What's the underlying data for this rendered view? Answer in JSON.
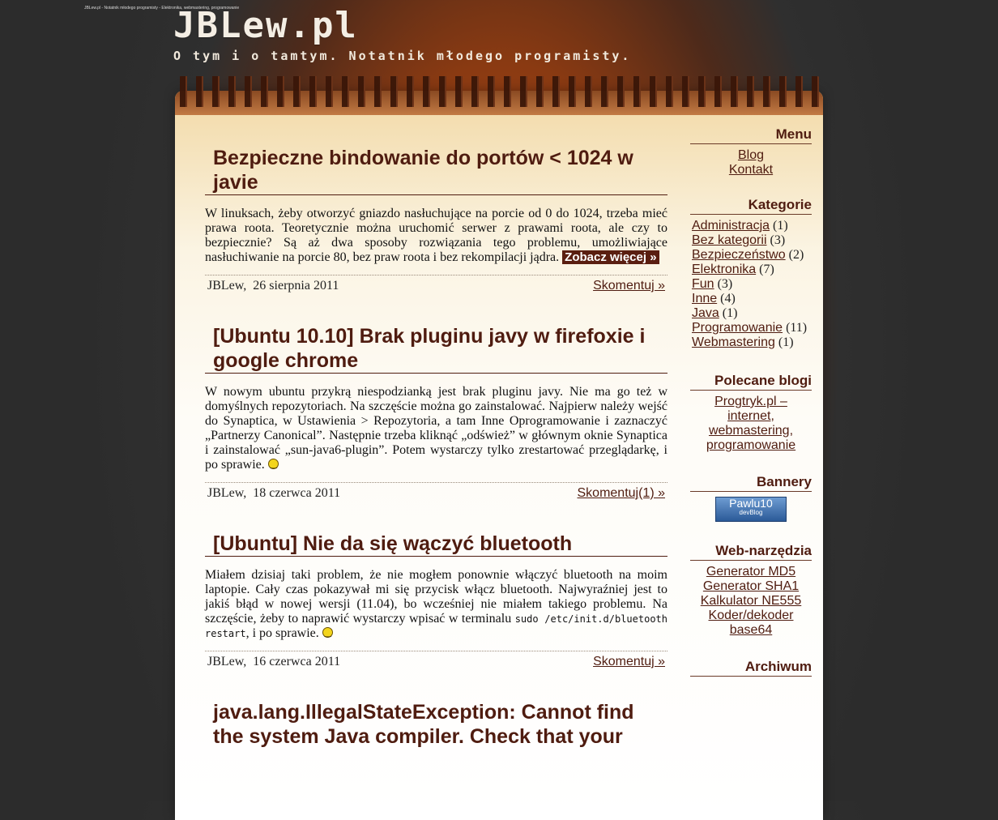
{
  "window": {
    "title": "JBLew.pl - Notatnik młodego programisty - Elektronika, webmastering, programowanie"
  },
  "header": {
    "logo": "JBLew.pl",
    "tagline": "O tym i o tamtym. Notatnik młodego programisty."
  },
  "posts": [
    {
      "title": "Bezpieczne bindowanie do portów < 1024 w javie",
      "body": "W linuksach, żeby otworzyć gniazdo nasłuchujące na porcie od 0 do 1024, trzeba mieć prawa roota. Teoretycznie można uruchomić serwer z prawami roota, ale czy to bezpiecznie? Są aż dwa sposoby rozwiązania tego problemu, umożliwiające nasłuchiwanie na porcie 80, bez praw roota i bez rekompilacji jądra.",
      "more": "Zobacz więcej »",
      "author": "JBLew,",
      "date": "26 sierpnia 2011",
      "comments": "Skomentuj »"
    },
    {
      "title": "[Ubuntu 10.10] Brak pluginu javy w firefoxie i google chrome",
      "body": "W nowym ubuntu przykrą niespodzianką jest brak pluginu javy. Nie ma go też w domyślnych repozytoriach. Na szczęście można go zainstalować. Najpierw należy wejść do Synaptica, w Ustawienia > Repozytoria, a tam Inne Oprogramowanie i zaznaczyć „Partnerzy Canonical”. Następnie trzeba kliknąć „odśwież” w głównym oknie Synaptica i zainstalować „sun-java6-plugin”. Potem wystarczy tylko zrestartować przeglądarkę, i po sprawie.",
      "author": "JBLew,",
      "date": "18 czerwca 2011",
      "comments": "Skomentuj(1) »"
    },
    {
      "title": "[Ubuntu] Nie da się wączyć bluetooth",
      "body": "Miałem dzisiaj taki problem, że nie mogłem ponownie włączyć bluetooth na moim laptopie. Cały czas pokazywał mi się przycisk włącz bluetooth. Najwyraźniej jest to jakiś błąd w nowej wersji (11.04), bo wcześniej nie miałem takiego problemu. Na szczęście, żeby to naprawić wystarczy wpisać w terminalu",
      "code": "sudo /etc/init.d/bluetooth restart",
      "body_end": ", i po sprawie.",
      "author": "JBLew,",
      "date": "16 czerwca 2011",
      "comments": "Skomentuj »"
    },
    {
      "title": "java.lang.IllegalStateException: Cannot find the system Java compiler. Check that your"
    }
  ],
  "sidebar": {
    "menu": {
      "title": "Menu",
      "items": [
        "Blog",
        "Kontakt"
      ]
    },
    "categories": {
      "title": "Kategorie",
      "items": [
        {
          "name": "Administracja",
          "count": "(1)"
        },
        {
          "name": "Bez kategorii",
          "count": "(3)"
        },
        {
          "name": "Bezpieczeństwo",
          "count": "(2)"
        },
        {
          "name": "Elektronika",
          "count": "(7)"
        },
        {
          "name": "Fun",
          "count": "(3)"
        },
        {
          "name": "Inne",
          "count": "(4)"
        },
        {
          "name": "Java",
          "count": "(1)"
        },
        {
          "name": "Programowanie",
          "count": "(11)"
        },
        {
          "name": "Webmastering",
          "count": "(1)"
        }
      ]
    },
    "blogs": {
      "title": "Polecane blogi",
      "link": "Progtryk.pl – internet, webmastering, programowanie"
    },
    "banners": {
      "title": "Bannery",
      "banner_main": "Pawlu10",
      "banner_sub": "devBlog"
    },
    "tools": {
      "title": "Web-narzędzia",
      "items": [
        "Generator MD5",
        "Generator SHA1",
        "Kalkulator NE555",
        "Koder/dekoder base64"
      ]
    },
    "archive": {
      "title": "Archiwum"
    }
  },
  "colors": {
    "accent": "#4f1c10",
    "paper": "#fefcf7",
    "background": "#2c2c2c"
  }
}
